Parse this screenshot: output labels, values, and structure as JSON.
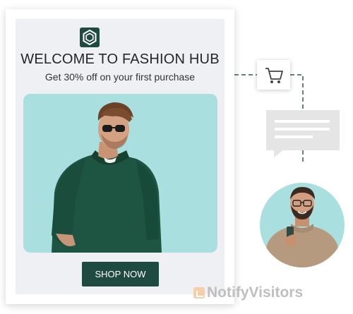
{
  "promo": {
    "headline": "WELCOME TO FASHION HUB",
    "subheadline": "Get 30% off on your first purchase",
    "cta_label": "SHOP NOW"
  },
  "icons": {
    "logo": "hexagon-logo-icon",
    "cart": "shopping-cart-icon",
    "chat": "chat-bubble-icon"
  },
  "watermark": {
    "text": "NotifyVisitors"
  },
  "colors": {
    "brand_dark_green": "#1f4a41",
    "hero_background": "#a9dfde",
    "card_background": "#eff0f4",
    "chat_bubble": "#e5e5e5",
    "watermark_text": "#bfbfbf"
  }
}
